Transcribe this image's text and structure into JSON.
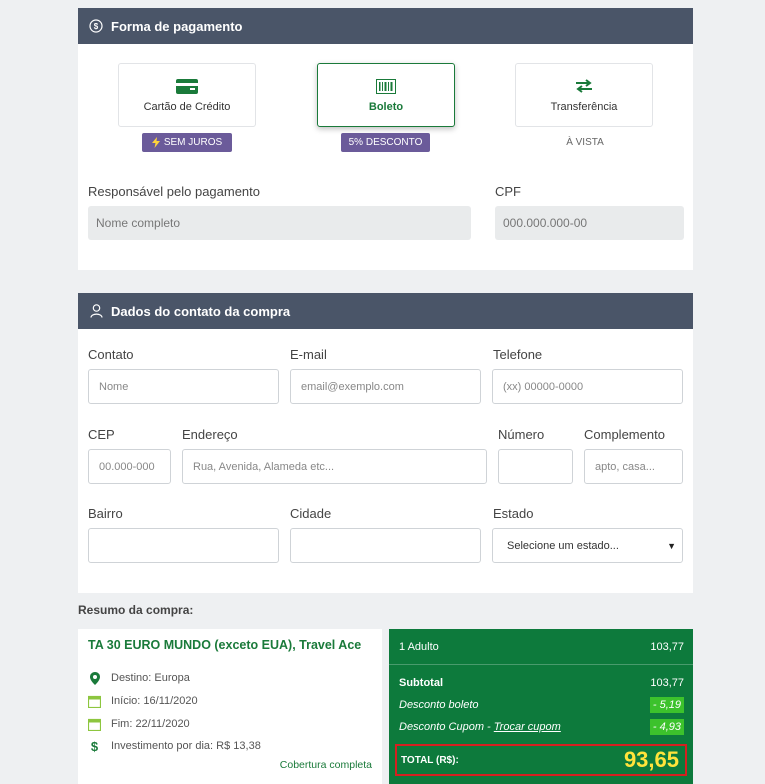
{
  "payment": {
    "title": "Forma de pagamento",
    "options": [
      {
        "label": "Cartão de Crédito",
        "tag": "SEM JUROS"
      },
      {
        "label": "Boleto",
        "tag": "5% DESCONTO"
      },
      {
        "label": "Transferência",
        "tag": "À VISTA"
      }
    ],
    "responsible_label": "Responsável pelo pagamento",
    "responsible_placeholder": "Nome completo",
    "cpf_label": "CPF",
    "cpf_placeholder": "000.000.000-00"
  },
  "contact": {
    "title": "Dados do contato da compra",
    "contato_label": "Contato",
    "contato_placeholder": "Nome",
    "email_label": "E-mail",
    "email_placeholder": "email@exemplo.com",
    "telefone_label": "Telefone",
    "telefone_placeholder": "(xx) 00000-0000",
    "cep_label": "CEP",
    "cep_placeholder": "00.000-000",
    "endereco_label": "Endereço",
    "endereco_placeholder": "Rua, Avenida, Alameda etc...",
    "numero_label": "Número",
    "complemento_label": "Complemento",
    "complemento_placeholder": "apto, casa...",
    "bairro_label": "Bairro",
    "cidade_label": "Cidade",
    "estado_label": "Estado",
    "estado_value": "Selecione um estado..."
  },
  "summary": {
    "title": "Resumo da compra:",
    "product": "TA 30 EURO MUNDO (exceto EUA), Travel Ace",
    "destino": "Destino: Europa",
    "inicio": "Início: 16/11/2020",
    "fim": "Fim: 22/11/2020",
    "investimento": "Investimento por dia: R$ 13,38",
    "coverage_link": "Cobertura completa",
    "adult_label": "1 Adulto",
    "adult_value": "103,77",
    "subtotal_label": "Subtotal",
    "subtotal_value": "103,77",
    "boleto_discount_label": "Desconto boleto",
    "boleto_discount_value": "- 5,19",
    "cupom_discount_label": "Desconto Cupom -",
    "cupom_link": "Trocar cupom",
    "cupom_discount_value": "- 4,93",
    "total_label": "TOTAL (R$):",
    "total_value": "93,65"
  },
  "colors": {
    "header": "#4a5568",
    "accent_green": "#1a7a3a",
    "totals_bg": "#0d7a3c",
    "tag_purple": "#6b5b9a",
    "total_yellow": "#ffe33b",
    "highlight_red": "#d62020"
  }
}
